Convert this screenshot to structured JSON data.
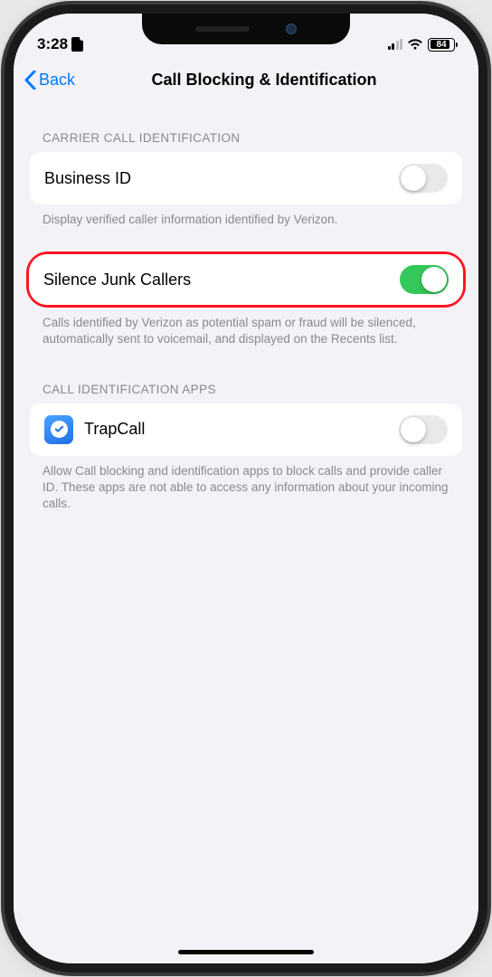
{
  "status": {
    "time": "3:28",
    "battery_pct": "84"
  },
  "nav": {
    "back_label": "Back",
    "title": "Call Blocking & Identification"
  },
  "section1": {
    "header": "CARRIER CALL IDENTIFICATION",
    "item1_label": "Business ID",
    "item1_on": false,
    "footer1": "Display verified caller information identified by Verizon.",
    "item2_label": "Silence Junk Callers",
    "item2_on": true,
    "footer2": "Calls identified by Verizon as potential spam or fraud will be silenced, automatically sent to voicemail, and displayed on the Recents list."
  },
  "section2": {
    "header": "CALL IDENTIFICATION APPS",
    "item1_label": "TrapCall",
    "item1_on": false,
    "footer": "Allow Call blocking and identification apps to block calls and provide caller ID. These apps are not able to access any information about your incoming calls."
  },
  "icons": {
    "back": "chevron-left",
    "sim": "sim-card",
    "wifi": "wifi",
    "trapcall": "speech-bubble-check"
  },
  "colors": {
    "tint": "#007aff",
    "switch_on": "#34c759",
    "highlight": "#ff1520",
    "background": "#f2f2f7"
  }
}
